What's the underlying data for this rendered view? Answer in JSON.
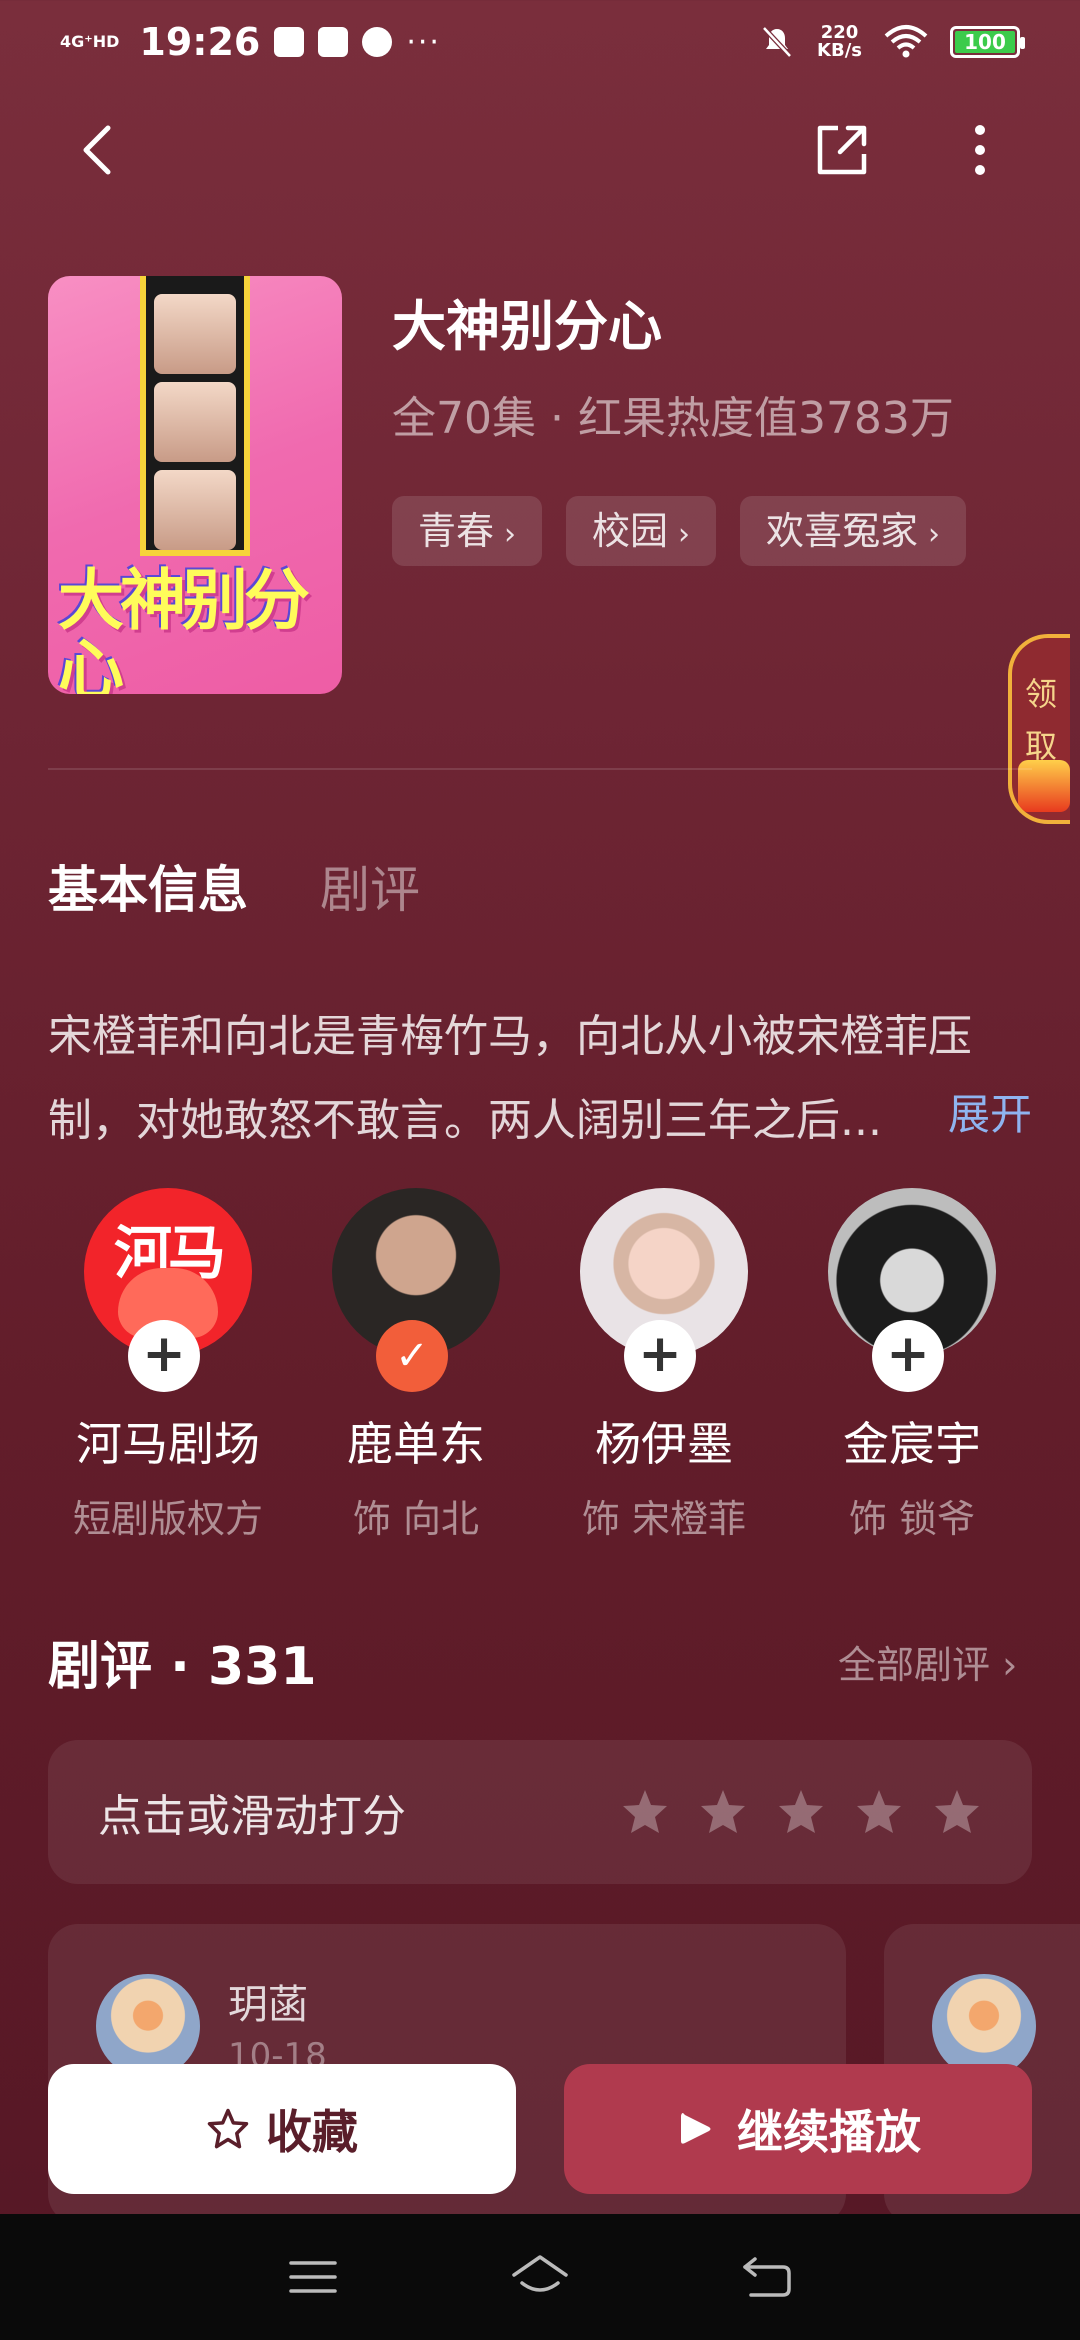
{
  "status_bar": {
    "network": "4G⁺HD",
    "time": "19:26",
    "dots": "···",
    "speed_value": "220",
    "speed_unit": "KB/s",
    "battery": "100",
    "battery_color": "#3ccb4b"
  },
  "drama": {
    "title": "大神别分心",
    "meta": "全70集 · 红果热度值3783万",
    "cover_art_text": "大神别分心",
    "tags": [
      "青春",
      "校园",
      "欢喜冤家"
    ]
  },
  "claim_badge": {
    "label_1": "领",
    "label_2": "取"
  },
  "tabs": {
    "basic": "基本信息",
    "review": "剧评"
  },
  "description": {
    "text": "宋橙菲和向北是青梅竹马，向北从小被宋橙菲压制，对她敢怒不敢言。两人阔别三年之后...",
    "expand": "展开"
  },
  "cast": [
    {
      "name": "河马剧场",
      "role": "短剧版权方",
      "following": false,
      "avatar_text": "河马"
    },
    {
      "name": "鹿单东",
      "role": "饰 向北",
      "following": true
    },
    {
      "name": "杨伊墨",
      "role": "饰 宋橙菲",
      "following": false
    },
    {
      "name": "金宸宇",
      "role": "饰 锁爷",
      "following": false
    }
  ],
  "reviews": {
    "heading": "剧评 · 331",
    "all_link": "全部剧评 ›",
    "rate_prompt": "点击或滑动打分",
    "star_count": 5,
    "first": {
      "user": "玥菡",
      "date": "10-18"
    }
  },
  "actions": {
    "favorite": "收藏",
    "play": "继续播放"
  },
  "colors": {
    "accent": "#b03a4e",
    "follow_on": "#f25e3a",
    "link": "#8fb4f0"
  }
}
